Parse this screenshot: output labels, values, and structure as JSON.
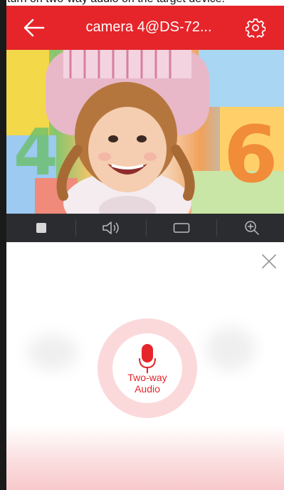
{
  "caption_fragment": "turn on two-way audio on the target device.",
  "header": {
    "title": "camera 4@DS-72...",
    "back_icon": "arrow-left-icon",
    "settings_icon": "gear-icon",
    "background": "#e5252a"
  },
  "video": {
    "description_icon": "live-camera-feed"
  },
  "toolbar": {
    "items": [
      {
        "icon": "stop-icon"
      },
      {
        "icon": "speaker-icon"
      },
      {
        "icon": "window-icon"
      },
      {
        "icon": "zoom-in-icon"
      }
    ]
  },
  "talk_panel": {
    "close_icon": "close-icon",
    "mic_icon": "microphone-icon",
    "label": "Two-way\nAudio",
    "accent": "#e5252a"
  }
}
